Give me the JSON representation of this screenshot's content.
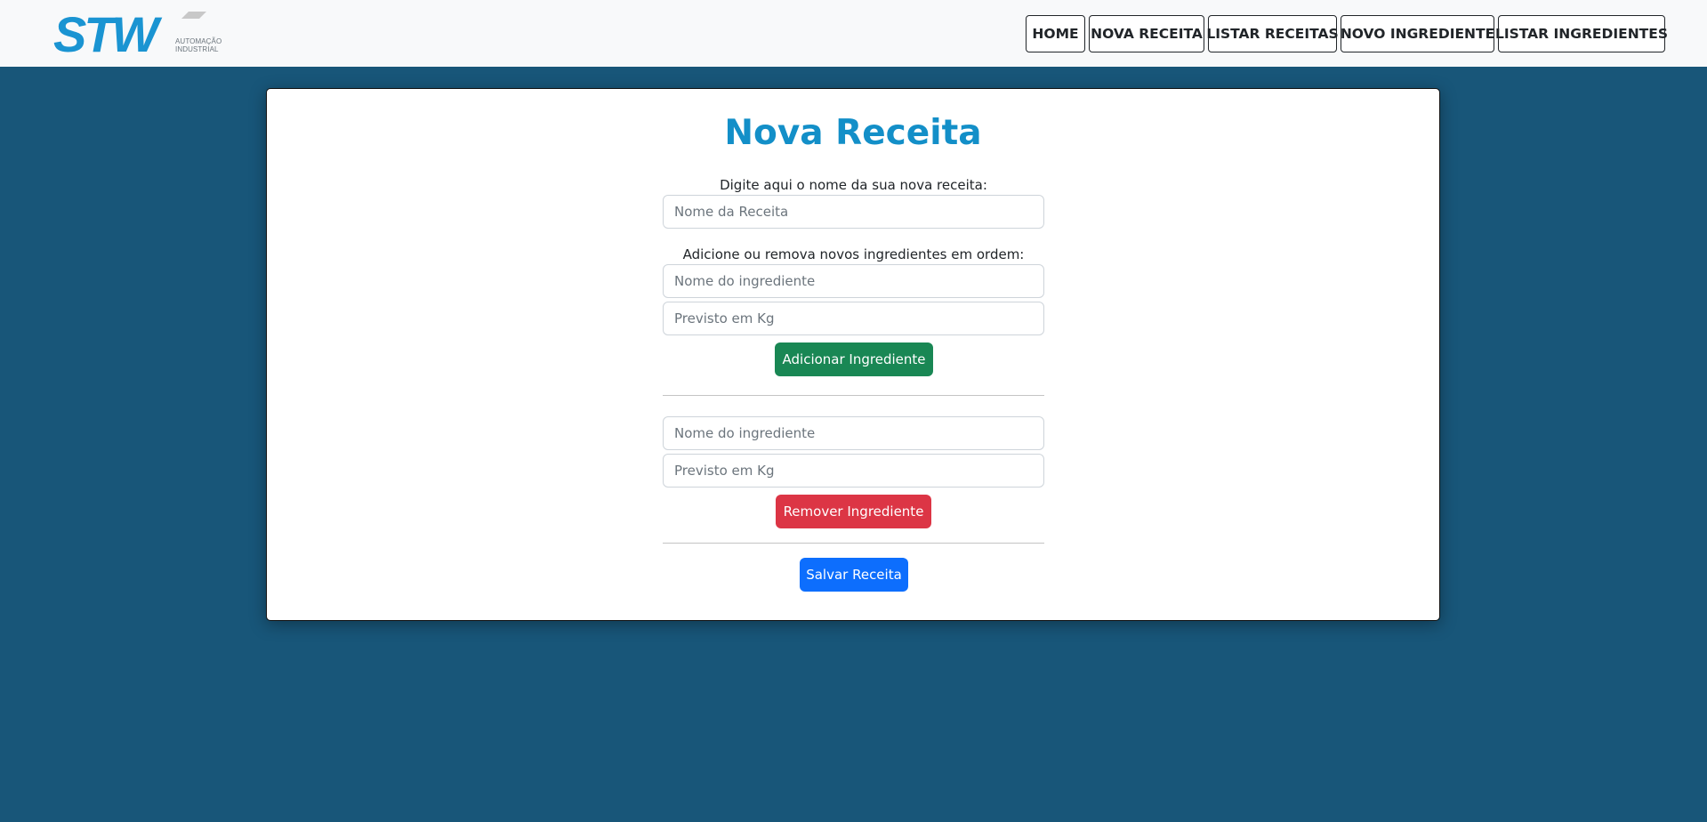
{
  "colors": {
    "page_background": "#185679",
    "navbar_background": "#f8f9fa",
    "title": "#138fc8",
    "brand_blue": "#1a94d2",
    "btn_success": "#198754",
    "btn_danger": "#dc3545",
    "btn_primary": "#0d6efd"
  },
  "header": {
    "logo": {
      "text": "STW",
      "subtitle_line1": "AUTOMAÇÃO",
      "subtitle_line2": "INDUSTRIAL"
    },
    "nav": [
      {
        "label": "HOME"
      },
      {
        "label": "NOVA RECEITA"
      },
      {
        "label": "LISTAR RECEITAS"
      },
      {
        "label": "NOVO INGREDIENTE"
      },
      {
        "label": "LISTAR INGREDIENTES"
      }
    ]
  },
  "main": {
    "title": "Nova Receita",
    "recipe_name_label": "Digite aqui o nome da sua nova receita:",
    "recipe_name_placeholder": "Nome da Receita",
    "recipe_name_value": "",
    "ingredients_label": "Adicione ou remova novos ingredientes em ordem:",
    "add_section": {
      "ingredient_placeholder": "Nome do ingrediente",
      "ingredient_value": "",
      "weight_placeholder": "Previsto em Kg",
      "weight_value": "",
      "button_label": "Adicionar Ingrediente"
    },
    "remove_section": {
      "ingredient_placeholder": "Nome do ingrediente",
      "ingredient_value": "",
      "weight_placeholder": "Previsto em Kg",
      "weight_value": "",
      "button_label": "Remover Ingrediente"
    },
    "save_button_label": "Salvar Receita"
  }
}
